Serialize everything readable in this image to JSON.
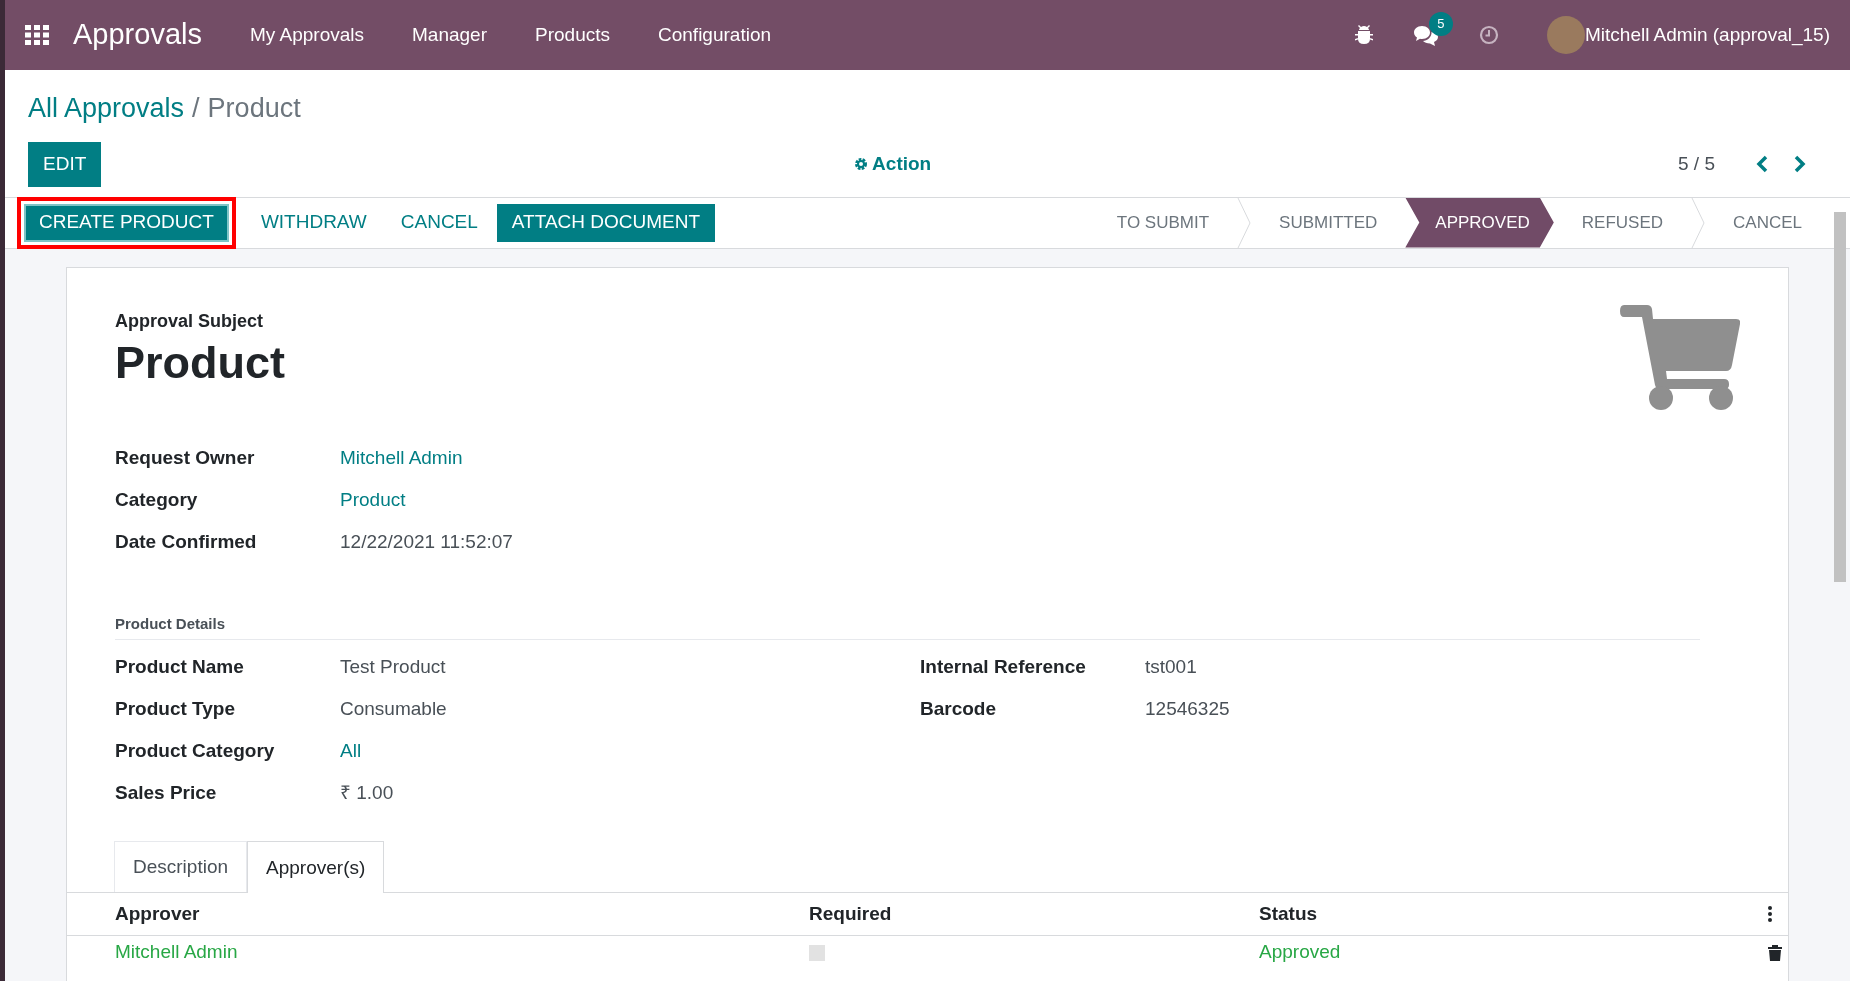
{
  "navbar": {
    "app_name": "Approvals",
    "menu": [
      "My Approvals",
      "Manager",
      "Products",
      "Configuration"
    ],
    "message_count": "5",
    "user": "Mitchell Admin (approval_15)"
  },
  "breadcrumb": {
    "parent": "All Approvals",
    "separator": "/",
    "current": "Product"
  },
  "control_panel": {
    "edit": "EDIT",
    "action": "Action",
    "pager": "5 / 5"
  },
  "header_buttons": [
    {
      "label": "CREATE PRODUCT",
      "kind": "primary",
      "highlighted": true
    },
    {
      "label": "WITHDRAW",
      "kind": "link",
      "highlighted": false
    },
    {
      "label": "CANCEL",
      "kind": "link",
      "highlighted": false
    },
    {
      "label": "ATTACH DOCUMENT",
      "kind": "primary",
      "highlighted": false
    }
  ],
  "stages": [
    {
      "label": "TO SUBMIT",
      "selected": false
    },
    {
      "label": "SUBMITTED",
      "selected": false
    },
    {
      "label": "APPROVED",
      "selected": true
    },
    {
      "label": "REFUSED",
      "selected": false
    },
    {
      "label": "CANCEL",
      "selected": false
    }
  ],
  "form": {
    "subject_label": "Approval Subject",
    "subject": "Product",
    "fields": [
      {
        "label": "Request Owner",
        "value": "Mitchell Admin",
        "kind": "link"
      },
      {
        "label": "Category",
        "value": "Product",
        "kind": "link"
      },
      {
        "label": "Date Confirmed",
        "value": "12/22/2021 11:52:07",
        "kind": "text"
      }
    ],
    "section_title": "Product Details",
    "left_fields": [
      {
        "label": "Product Name",
        "value": "Test Product",
        "kind": "text"
      },
      {
        "label": "Product Type",
        "value": "Consumable",
        "kind": "text"
      },
      {
        "label": "Product Category",
        "value": "All",
        "kind": "link"
      },
      {
        "label": "Sales Price",
        "value": "₹ 1.00",
        "kind": "text"
      }
    ],
    "right_fields": [
      {
        "label": "Internal Reference",
        "value": "tst001",
        "kind": "text"
      },
      {
        "label": "Barcode",
        "value": "12546325",
        "kind": "text"
      }
    ]
  },
  "tabs": [
    {
      "label": "Description",
      "selected": false
    },
    {
      "label": "Approver(s)",
      "selected": true
    }
  ],
  "table": {
    "columns": [
      "Approver",
      "Required",
      "Status"
    ],
    "rows": [
      {
        "approver": "Mitchell Admin",
        "required": false,
        "status": "Approved"
      }
    ]
  }
}
